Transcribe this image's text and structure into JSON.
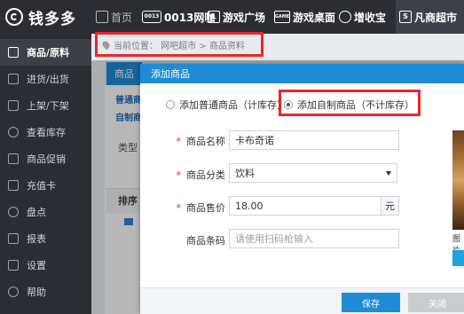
{
  "app": {
    "name": "钱多多"
  },
  "topnav": {
    "items": [
      {
        "label": "首页",
        "icon": "home-icon"
      },
      {
        "label": "0013网咖",
        "icon": "cafe-logo-icon",
        "icon_text": "0013"
      },
      {
        "label": "游戏广场",
        "icon": "game-square-icon",
        "icon_text": "L"
      },
      {
        "label": "游戏桌面",
        "icon": "game-desktop-icon",
        "icon_text": "GAME"
      },
      {
        "label": "增收宝",
        "icon": "revenue-icon"
      },
      {
        "label": "凡商超市",
        "icon": "supermarket-icon",
        "icon_text": "S"
      }
    ]
  },
  "sidebar": {
    "items": [
      {
        "label": "商品/原料",
        "icon": "barcode-icon",
        "active": true
      },
      {
        "label": "进货/出货",
        "icon": "box-icon"
      },
      {
        "label": "上架/下架",
        "icon": "shelf-icon"
      },
      {
        "label": "查看库存",
        "icon": "search-icon"
      },
      {
        "label": "商品促销",
        "icon": "tag-icon"
      },
      {
        "label": "充值卡",
        "icon": "card-icon"
      },
      {
        "label": "盘点",
        "icon": "settings-gear-icon"
      },
      {
        "label": "报表",
        "icon": "report-icon"
      },
      {
        "label": "设置",
        "icon": "checkbox-icon"
      },
      {
        "label": "帮助",
        "icon": "help-icon"
      }
    ]
  },
  "breadcrumb": {
    "text": "当前位置： 网吧超市 > 商品资料"
  },
  "background": {
    "tab_label": "商品",
    "link1": "普通商",
    "link2": "自制商",
    "type_label": "类型",
    "sort_label": "排序"
  },
  "dialog": {
    "title": "添加商品",
    "radio_normal": "添加普通商品（计库存）",
    "radio_custom": "添加自制商品（不计库存）",
    "selected": "custom",
    "fields": {
      "name": {
        "label": "商品名称",
        "required": true,
        "value": "卡布奇诺"
      },
      "category": {
        "label": "商品分类",
        "required": true,
        "value": "饮料"
      },
      "price": {
        "label": "商品售价",
        "required": true,
        "value": "18.00",
        "unit": "元"
      },
      "barcode": {
        "label": "商品条码",
        "required": false,
        "placeholder": "请使用扫码枪输入"
      }
    },
    "image_label": "图片",
    "save_label": "保存",
    "close_label": "关闭"
  },
  "colors": {
    "topbar": "#2b2d33",
    "accent": "#1f8bd6",
    "highlight": "#e8262b"
  }
}
